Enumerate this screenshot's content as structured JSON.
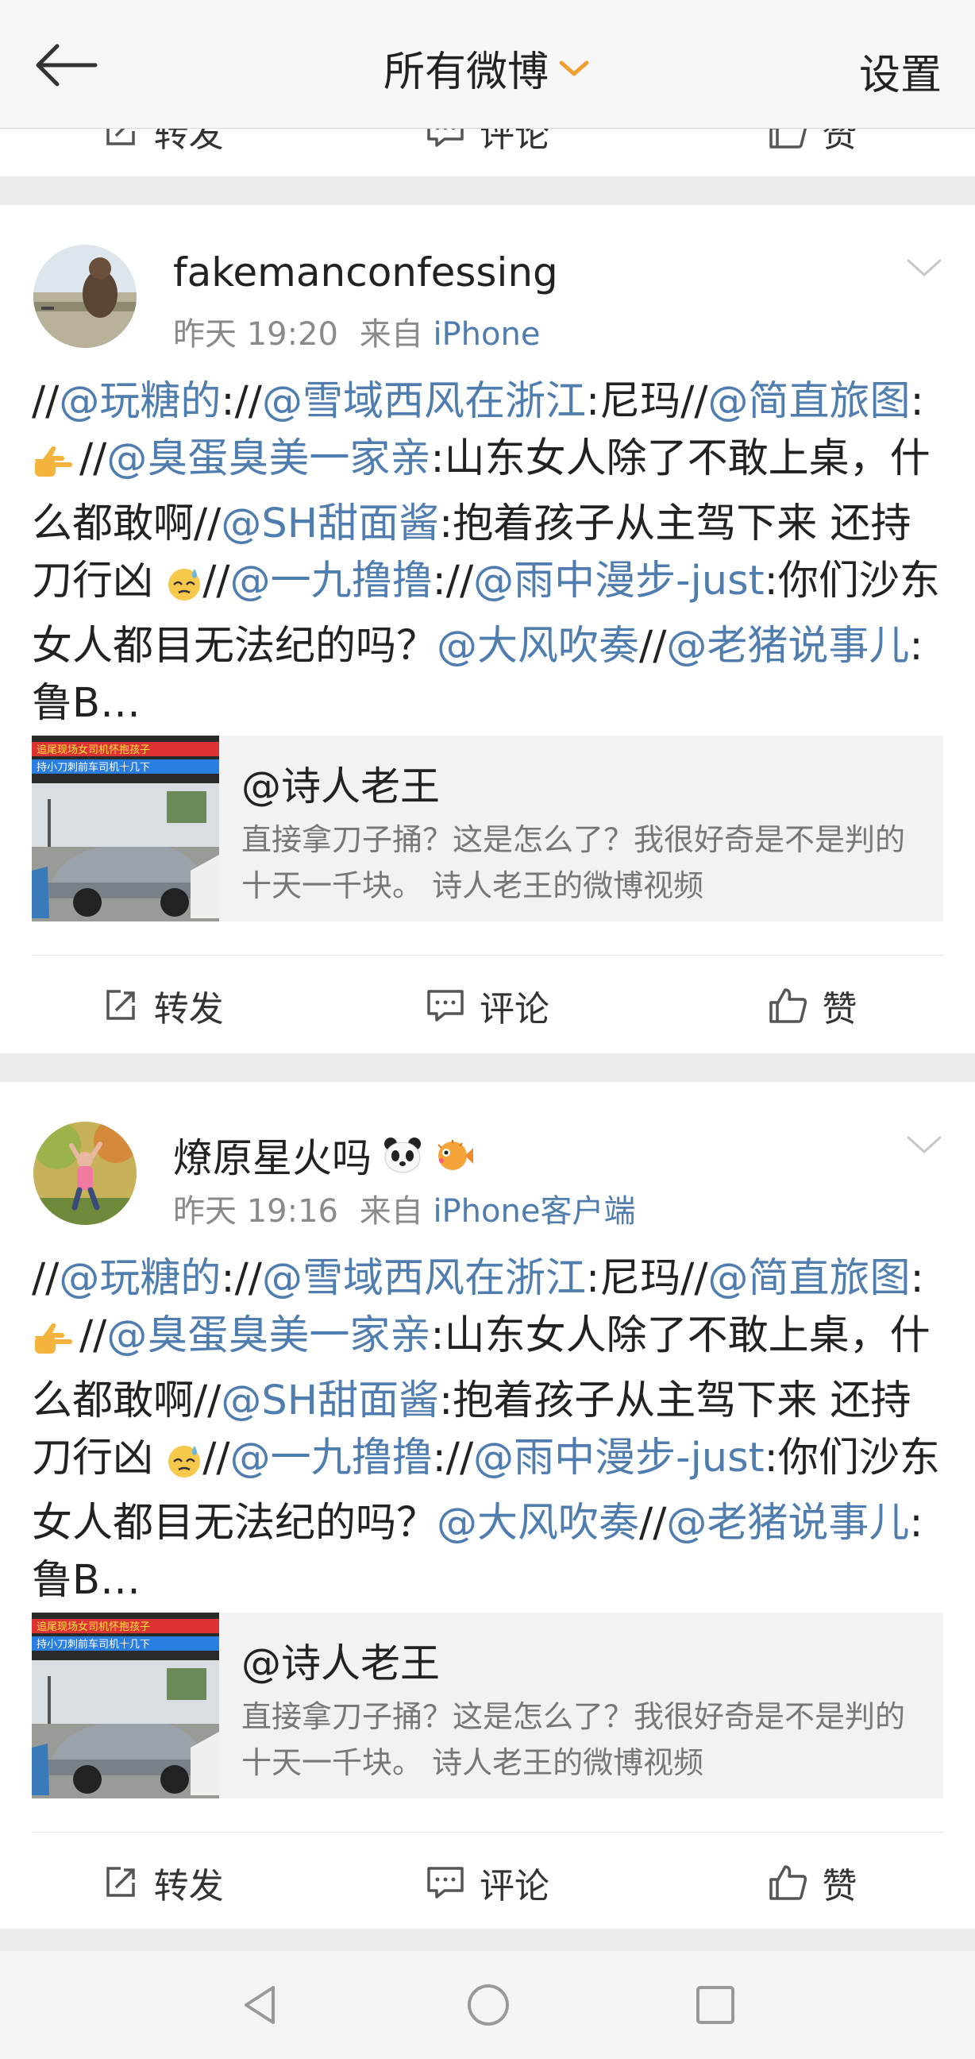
{
  "header": {
    "title": "所有微博",
    "settings_label": "设置"
  },
  "prev_actions": {
    "repost": "转发",
    "comment": "评论",
    "like": "赞"
  },
  "posts": [
    {
      "username": "fakemanconfessing",
      "time": "昨天 19:20",
      "source_prefix": "来自",
      "source": "iPhone",
      "text_parts": {
        "s1": "//",
        "m1": "@玩糖的",
        "s2": "://",
        "m2": "@雪域西风在浙江",
        "s3": ":尼玛//",
        "m3": "@简直旅图",
        "s4": ":",
        "s5": "//",
        "m4": "@臭蛋臭美一家亲",
        "s6": ":山东女人除了不敢上桌，什么都敢啊//",
        "m5": "@SH甜面酱",
        "s7": ":抱着孩子从主驾下来 还持刀行凶 ",
        "s8": "//",
        "m6": "@一九撸撸",
        "s9": "://",
        "m7": "@雨中漫步-just",
        "s10": ":你们沙东女人都目无法纪的吗？",
        "m8": "@大风吹奏",
        "s11": "//",
        "m9": "@老猪说事儿",
        "s12": ":鲁B…"
      },
      "share": {
        "title": "@诗人老王",
        "description": "直接拿刀子捅？这是怎么了？我很好奇是不是判的十天一千块。 诗人老王的微博视频",
        "thumb_caption_1": "追尾现场女司机怀抱孩子",
        "thumb_caption_2": "持小刀刺前车司机十几下"
      },
      "actions": {
        "repost": "转发",
        "comment": "评论",
        "like": "赞"
      }
    },
    {
      "username": "燎原星火吗",
      "time": "昨天 19:16",
      "source_prefix": "来自",
      "source": "iPhone客户端",
      "text_parts": {
        "s1": "//",
        "m1": "@玩糖的",
        "s2": "://",
        "m2": "@雪域西风在浙江",
        "s3": ":尼玛//",
        "m3": "@简直旅图",
        "s4": ":",
        "s5": "//",
        "m4": "@臭蛋臭美一家亲",
        "s6": ":山东女人除了不敢上桌，什么都敢啊//",
        "m5": "@SH甜面酱",
        "s7": ":抱着孩子从主驾下来 还持刀行凶 ",
        "s8": "//",
        "m6": "@一九撸撸",
        "s9": "://",
        "m7": "@雨中漫步-just",
        "s10": ":你们沙东女人都目无法纪的吗？",
        "m8": "@大风吹奏",
        "s11": "//",
        "m9": "@老猪说事儿",
        "s12": ":鲁B…"
      },
      "share": {
        "title": "@诗人老王",
        "description": "直接拿刀子捅？这是怎么了？我很好奇是不是判的十天一千块。 诗人老王的微博视频",
        "thumb_caption_1": "追尾现场女司机怀抱孩子",
        "thumb_caption_2": "持小刀刺前车司机十几下"
      },
      "actions": {
        "repost": "转发",
        "comment": "评论",
        "like": "赞"
      }
    }
  ],
  "icons": {
    "back": "back-arrow-icon",
    "dropdown": "chevron-down-icon",
    "repost": "repost-icon",
    "comment": "comment-icon",
    "like": "thumbs-up-icon",
    "nav_back": "nav-back-icon",
    "nav_home": "nav-home-icon",
    "nav_recents": "nav-recents-icon"
  },
  "colors": {
    "link": "#507daf",
    "accent_orange": "#f0a030",
    "meta_gray": "#8a8a8a"
  }
}
